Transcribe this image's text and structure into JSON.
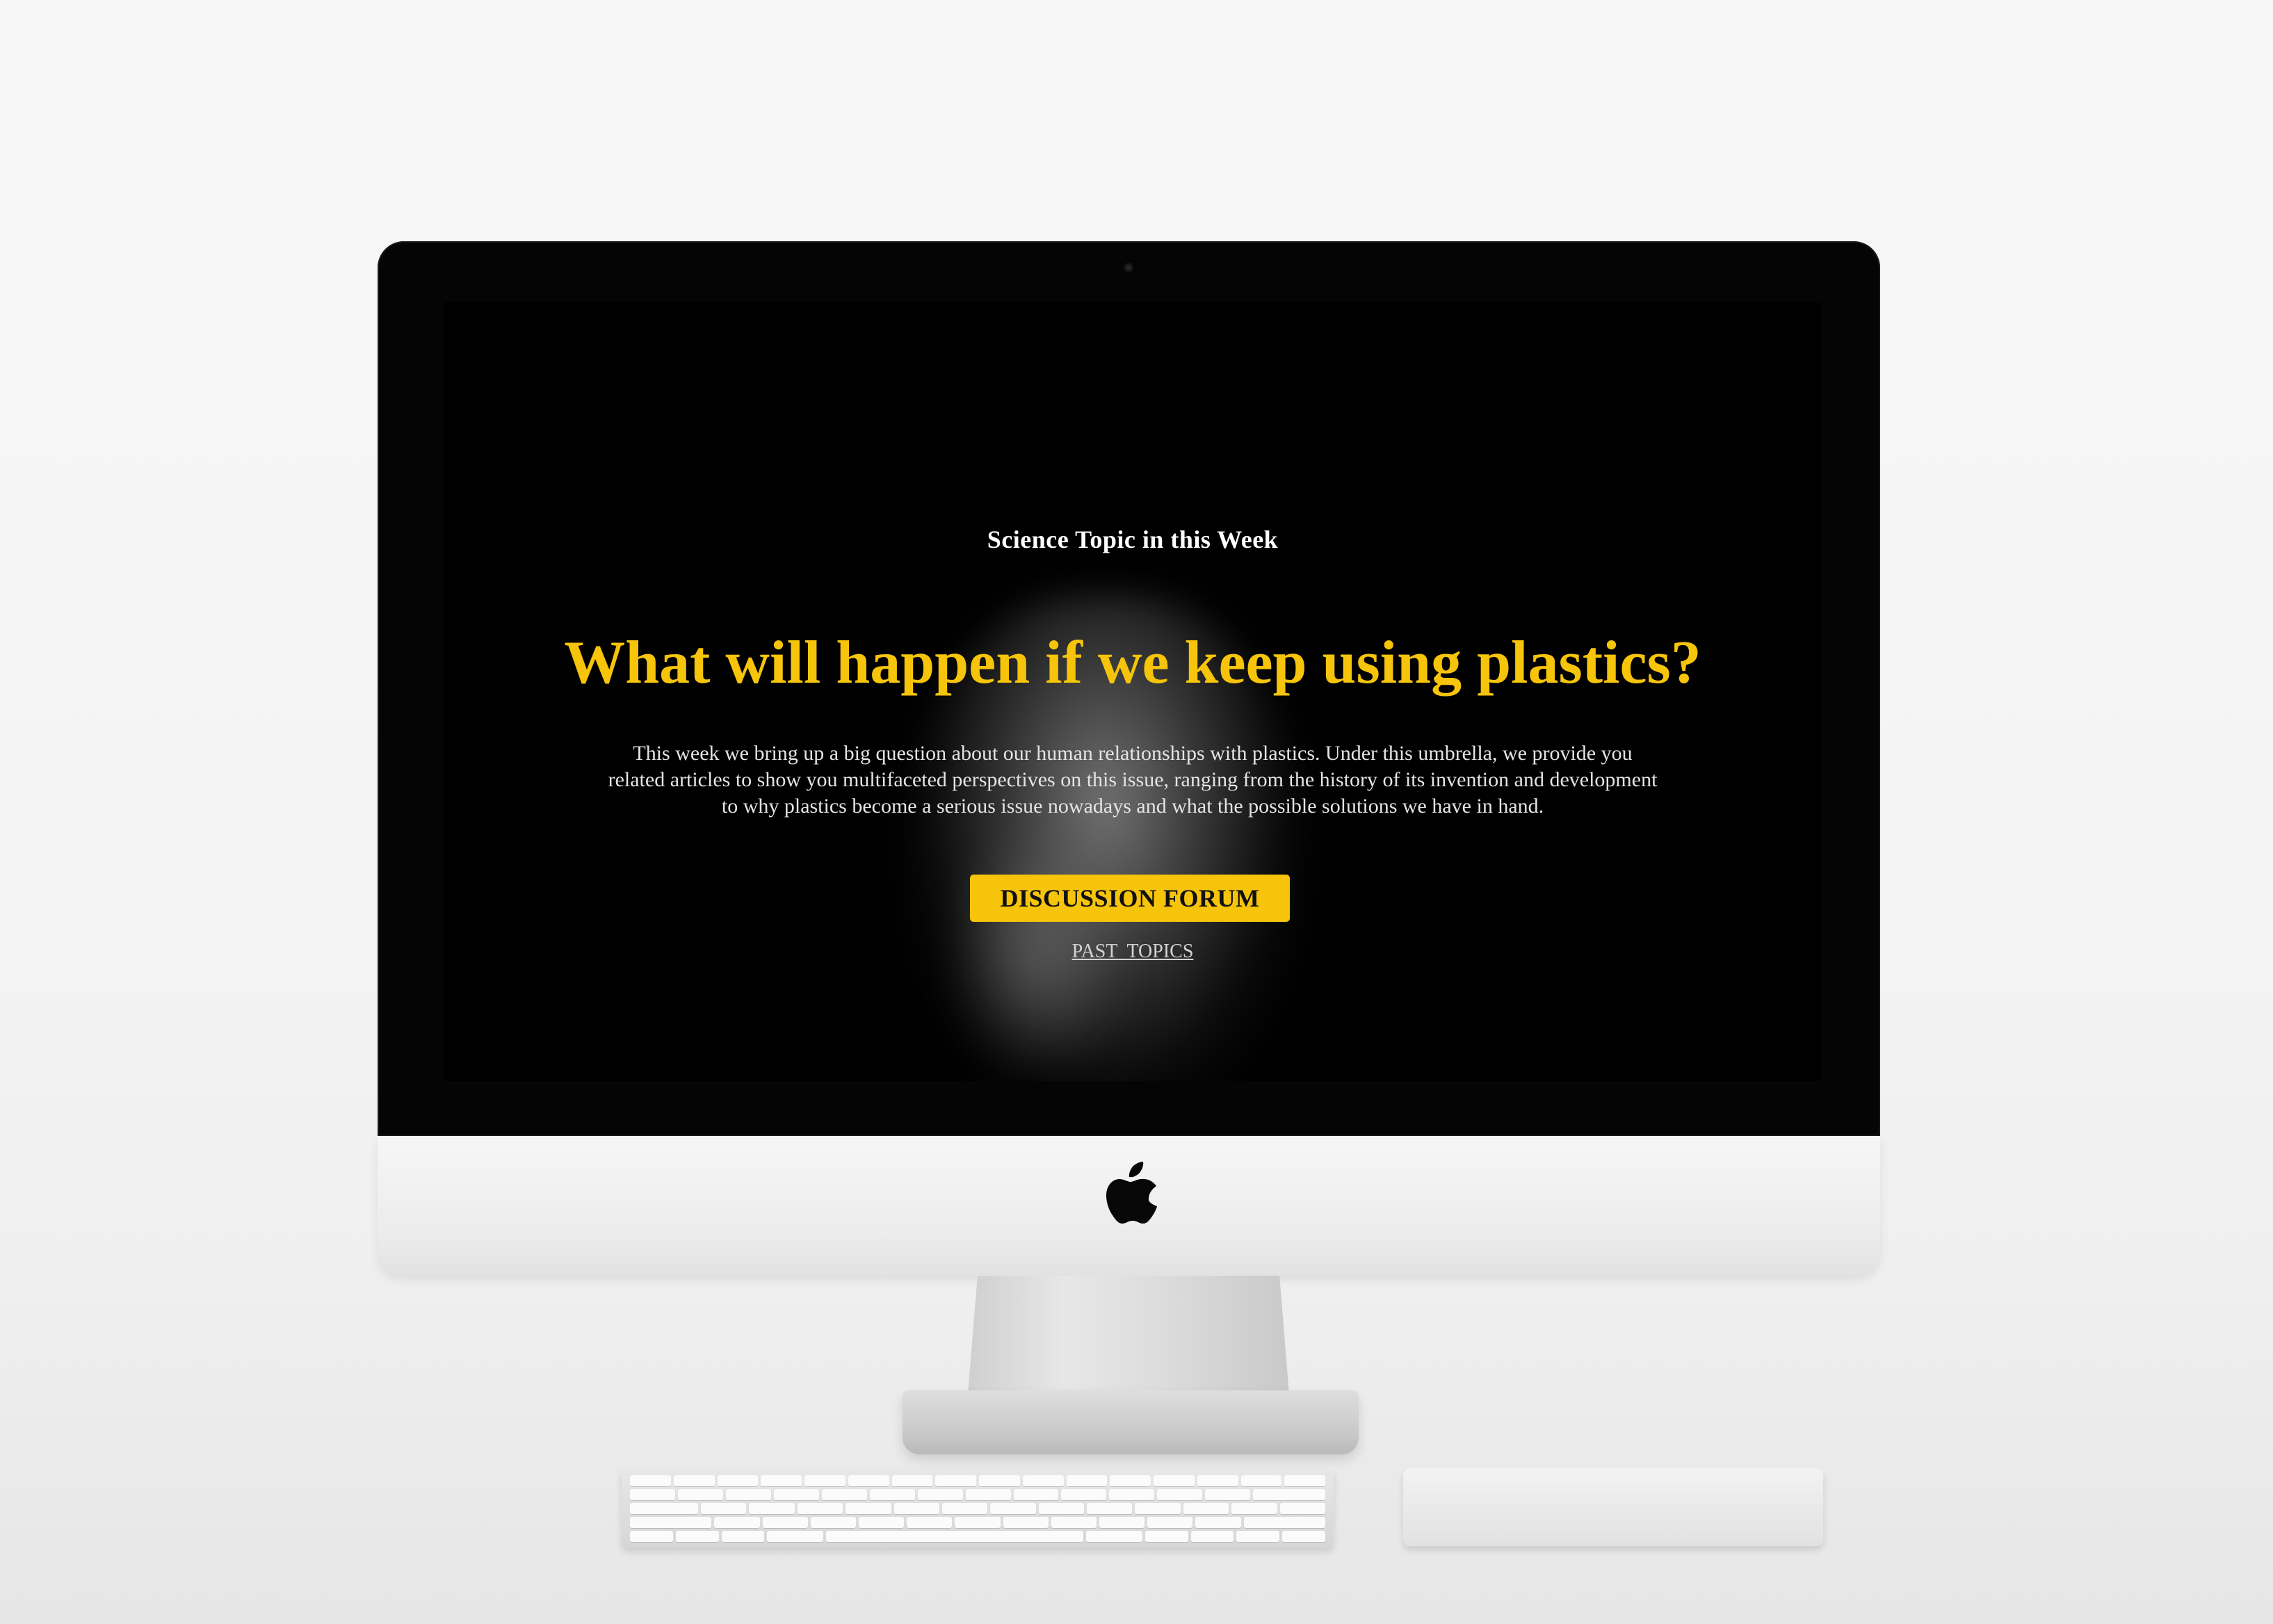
{
  "page": {
    "eyebrow": "Science Topic in this Week",
    "headline": "What will happen if we keep using plastics?",
    "intro": "This week we bring up a big question about our human relationships with plastics. Under this umbrella, we provide you related articles to show you multifaceted perspectives on this issue, ranging from the history of its invention and development to why plastics become a serious issue nowadays and what the possible solutions we have in hand.",
    "primary_button": "DISCUSSION FORUM",
    "secondary_link": "PAST  TOPICS"
  },
  "colors": {
    "accent": "#f6c40a",
    "background": "#000000",
    "text": "#ffffff"
  },
  "icons": {
    "brand_logo": "apple-logo-icon"
  }
}
